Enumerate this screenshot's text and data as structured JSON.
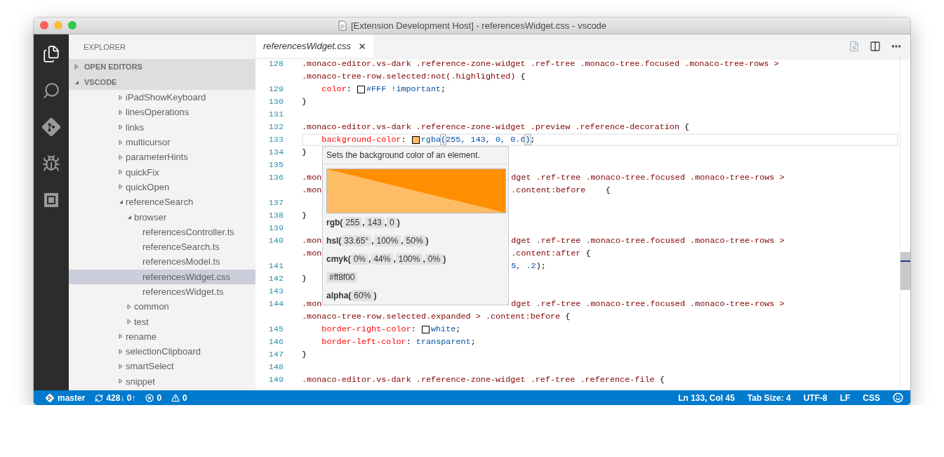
{
  "window": {
    "title": "[Extension Development Host] - referencesWidget.css - vscode"
  },
  "activity_bar": [
    {
      "kind": "files",
      "selected": true
    },
    {
      "kind": "search",
      "selected": false
    },
    {
      "kind": "git",
      "selected": false
    },
    {
      "kind": "debug",
      "selected": false
    },
    {
      "kind": "extensions",
      "selected": false
    }
  ],
  "sidebar": {
    "title": "EXPLORER",
    "sections": [
      {
        "label": "OPEN EDITORS",
        "expanded": false
      },
      {
        "label": "VSCODE",
        "expanded": true
      }
    ],
    "tree": [
      {
        "label": "iPadShowKeyboard",
        "kind": "folder",
        "expanded": false,
        "selected": false
      },
      {
        "label": "linesOperations",
        "kind": "folder",
        "expanded": false,
        "selected": false
      },
      {
        "label": "links",
        "kind": "folder",
        "expanded": false,
        "selected": false
      },
      {
        "label": "multicursor",
        "kind": "folder",
        "expanded": false,
        "selected": false
      },
      {
        "label": "parameterHints",
        "kind": "folder",
        "expanded": false,
        "selected": false
      },
      {
        "label": "quickFix",
        "kind": "folder",
        "expanded": false,
        "selected": false
      },
      {
        "label": "quickOpen",
        "kind": "folder",
        "expanded": false,
        "selected": false
      },
      {
        "label": "referenceSearch",
        "kind": "folder",
        "expanded": true,
        "selected": false,
        "children": [
          {
            "label": "browser",
            "kind": "folder",
            "expanded": true,
            "selected": false,
            "children": [
              {
                "label": "referencesController.ts",
                "kind": "file",
                "selected": false
              },
              {
                "label": "referenceSearch.ts",
                "kind": "file",
                "selected": false
              },
              {
                "label": "referencesModel.ts",
                "kind": "file",
                "selected": false
              },
              {
                "label": "referencesWidget.css",
                "kind": "file",
                "selected": true
              },
              {
                "label": "referencesWidget.ts",
                "kind": "file",
                "selected": false
              }
            ]
          },
          {
            "label": "common",
            "kind": "folder",
            "expanded": false,
            "selected": false
          },
          {
            "label": "test",
            "kind": "folder",
            "expanded": false,
            "selected": false
          }
        ]
      },
      {
        "label": "rename",
        "kind": "folder",
        "expanded": false,
        "selected": false
      },
      {
        "label": "selectionClipboard",
        "kind": "folder",
        "expanded": false,
        "selected": false
      },
      {
        "label": "smartSelect",
        "kind": "folder",
        "expanded": false,
        "selected": false
      },
      {
        "label": "snippet",
        "kind": "folder",
        "expanded": false,
        "selected": false
      }
    ]
  },
  "tabs": [
    {
      "label": "referencesWidget.css",
      "selected": true,
      "preview": true
    }
  ],
  "editor_rows": [
    {
      "num": "128",
      "current": false,
      "indented": false,
      "tokens": [
        {
          "kind": "selector",
          "text": ".monaco-editor.vs-dark .reference-zone-widget .ref-tree .monaco-tree.focused .monaco-tree-rows >"
        }
      ]
    },
    {
      "current": false,
      "indented": false,
      "tokens": [
        {
          "kind": "selector",
          "text": ".monaco-tree-row.selected:not(.highlighted) "
        },
        {
          "kind": "punct",
          "text": "{"
        }
      ]
    },
    {
      "num": "129",
      "current": false,
      "indented": true,
      "tokens": [
        {
          "kind": "property",
          "text": "color"
        },
        {
          "kind": "punct",
          "text": ": "
        },
        {
          "kind": "swatch",
          "color": "#ffffff"
        },
        {
          "kind": "value",
          "text": "#FFF"
        },
        {
          "kind": "value",
          "text": " !important"
        },
        {
          "kind": "punct",
          "text": ";"
        }
      ]
    },
    {
      "num": "130",
      "current": false,
      "indented": false,
      "tokens": [
        {
          "kind": "punct",
          "text": "}"
        }
      ]
    },
    {
      "num": "131",
      "tokens": []
    },
    {
      "num": "132",
      "current": false,
      "indented": false,
      "tokens": [
        {
          "kind": "selector",
          "text": ".monaco-editor.vs-dark .reference-zone-widget .preview .reference-decoration "
        },
        {
          "kind": "punct",
          "text": "{"
        }
      ]
    },
    {
      "num": "133",
      "current": true,
      "indented": true,
      "tokens": [
        {
          "kind": "property",
          "text": "background-color"
        },
        {
          "kind": "punct",
          "text": ": "
        },
        {
          "kind": "swatch",
          "color": "#ffbc66"
        },
        {
          "kind": "value",
          "text": "rgba"
        },
        {
          "kind": "bracket",
          "text": "("
        },
        {
          "kind": "value",
          "text": "255, 143, 0, 0.6"
        },
        {
          "kind": "bracket",
          "text": ")"
        },
        {
          "kind": "punct",
          "text": ";"
        }
      ]
    },
    {
      "num": "134",
      "current": false,
      "indented": false,
      "tokens": [
        {
          "kind": "punct",
          "text": "}"
        }
      ]
    },
    {
      "num": "135",
      "tokens": []
    },
    {
      "num": "136",
      "current": false,
      "indented": false,
      "tokens": [
        {
          "kind": "selector",
          "text": ".mon"
        }
      ],
      "right": [
        {
          "kind": "selector",
          "text": "dget .ref-tree .monaco-tree.focused .monaco-tree-rows >"
        }
      ]
    },
    {
      "current": false,
      "indented": false,
      "tokens": [
        {
          "kind": "selector",
          "text": ".mon"
        }
      ],
      "right": [
        {
          "kind": "selector",
          "text": ".content:before    "
        },
        {
          "kind": "punct",
          "text": "{"
        }
      ]
    },
    {
      "num": "137",
      "tokens": []
    },
    {
      "num": "138",
      "current": false,
      "indented": false,
      "tokens": [
        {
          "kind": "punct",
          "text": "}"
        }
      ]
    },
    {
      "num": "139",
      "tokens": []
    },
    {
      "num": "140",
      "current": false,
      "indented": false,
      "tokens": [
        {
          "kind": "selector",
          "text": ".mon"
        }
      ],
      "right": [
        {
          "kind": "selector",
          "text": "dget .ref-tree .monaco-tree.focused .monaco-tree-rows >"
        }
      ]
    },
    {
      "current": false,
      "indented": false,
      "tokens": [
        {
          "kind": "selector",
          "text": ".mon"
        }
      ],
      "right": [
        {
          "kind": "selector",
          "text": ".content:after "
        },
        {
          "kind": "punct",
          "text": "{"
        }
      ]
    },
    {
      "num": "141",
      "tokens": [],
      "right": [
        {
          "kind": "value",
          "text": "5, .2"
        },
        {
          "kind": "punct",
          "text": ");"
        }
      ]
    },
    {
      "num": "142",
      "current": false,
      "indented": false,
      "tokens": [
        {
          "kind": "punct",
          "text": "}"
        }
      ]
    },
    {
      "num": "143",
      "tokens": []
    },
    {
      "num": "144",
      "current": false,
      "indented": false,
      "tokens": [
        {
          "kind": "selector",
          "text": ".mon"
        }
      ],
      "right": [
        {
          "kind": "selector",
          "text": "dget .ref-tree .monaco-tree.focused .monaco-tree-rows >"
        }
      ]
    },
    {
      "current": false,
      "indented": false,
      "tokens": [
        {
          "kind": "selector",
          "text": ".monaco-tree-row.selected.expanded > .content:before "
        },
        {
          "kind": "punct",
          "text": "{"
        }
      ]
    },
    {
      "num": "145",
      "current": false,
      "indented": true,
      "tokens": [
        {
          "kind": "property",
          "text": "border-right-color"
        },
        {
          "kind": "punct",
          "text": ": "
        },
        {
          "kind": "swatch",
          "color": "#ffffff"
        },
        {
          "kind": "value",
          "text": "white"
        },
        {
          "kind": "punct",
          "text": ";"
        }
      ]
    },
    {
      "num": "146",
      "current": false,
      "indented": true,
      "tokens": [
        {
          "kind": "property",
          "text": "border-left-color"
        },
        {
          "kind": "punct",
          "text": ": "
        },
        {
          "kind": "value",
          "text": "transparent"
        },
        {
          "kind": "punct",
          "text": ";"
        }
      ]
    },
    {
      "num": "147",
      "current": false,
      "indented": false,
      "tokens": [
        {
          "kind": "punct",
          "text": "}"
        }
      ]
    },
    {
      "num": "148",
      "tokens": []
    },
    {
      "num": "149",
      "current": false,
      "indented": false,
      "tokens": [
        {
          "kind": "selector",
          "text": ".monaco-editor.vs-dark .reference-zone-widget .ref-tree .reference-file "
        },
        {
          "kind": "punct",
          "text": "{"
        }
      ]
    }
  ],
  "hover": {
    "description": "Sets the background color of an element.",
    "formats": [
      {
        "prefix": "rgb(",
        "values": [
          "255",
          "143",
          "0"
        ],
        "separator": ",",
        "suffix": ")"
      },
      {
        "prefix": "hsl(",
        "values": [
          "33.65°",
          "100%",
          "50%"
        ],
        "separator": ",",
        "suffix": ")"
      },
      {
        "prefix": "cmyk(",
        "values": [
          "0%",
          "44%",
          "100%",
          "0%"
        ],
        "separator": ",",
        "suffix": ")"
      },
      {
        "values": [
          "#ff8f00"
        ]
      },
      {
        "prefix": "alpha(",
        "values": [
          "60%"
        ],
        "suffix": ")"
      }
    ]
  },
  "status_bar": {
    "left": [
      {
        "kind": "branch",
        "text": "master"
      },
      {
        "kind": "sync",
        "text": "428↓ 0↑"
      },
      {
        "kind": "errors",
        "text": "0"
      },
      {
        "kind": "warnings",
        "text": "0"
      }
    ],
    "right": [
      {
        "kind": "text",
        "text": "Ln 133, Col 45"
      },
      {
        "kind": "text",
        "text": "Tab Size: 4"
      },
      {
        "kind": "text",
        "text": "UTF-8"
      },
      {
        "kind": "text",
        "text": "LF"
      },
      {
        "kind": "text",
        "text": "CSS"
      },
      {
        "kind": "feedback"
      }
    ]
  }
}
